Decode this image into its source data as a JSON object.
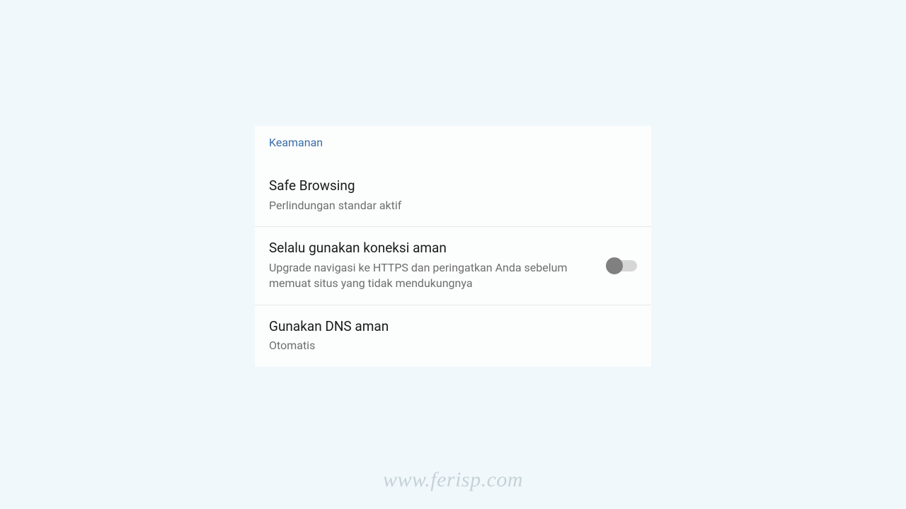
{
  "section": {
    "header": "Keamanan"
  },
  "settings": {
    "safeBrowsing": {
      "title": "Safe Browsing",
      "subtitle": "Perlindungan standar aktif"
    },
    "secureConnection": {
      "title": "Selalu gunakan koneksi aman",
      "subtitle": "Upgrade navigasi ke HTTPS dan peringatkan Anda sebelum memuat situs yang tidak mendukungnya",
      "toggleOn": false
    },
    "secureDns": {
      "title": "Gunakan DNS aman",
      "subtitle": "Otomatis"
    }
  },
  "watermark": "www.ferisp.com"
}
